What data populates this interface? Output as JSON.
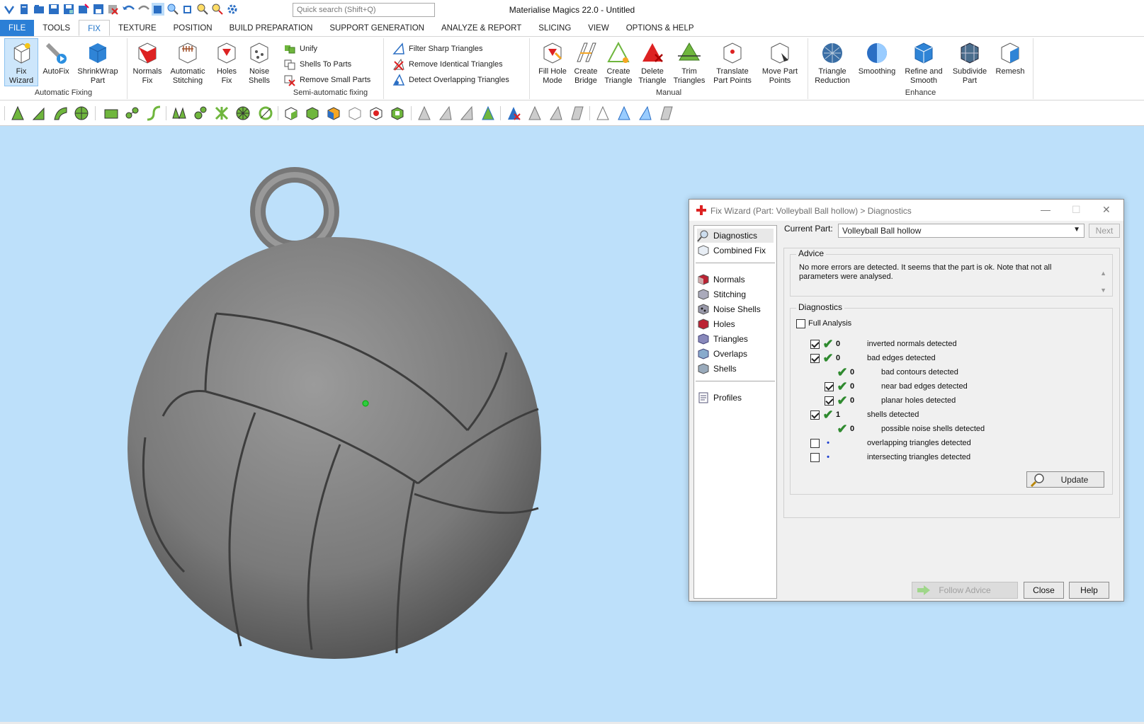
{
  "window": {
    "title": "Materialise Magics 22.0 - Untitled"
  },
  "quick_access": {
    "search_placeholder": "Quick search (Shift+Q)"
  },
  "menu": [
    "FILE",
    "TOOLS",
    "FIX",
    "TEXTURE",
    "POSITION",
    "BUILD PREPARATION",
    "SUPPORT GENERATION",
    "ANALYZE & REPORT",
    "SLICING",
    "VIEW",
    "OPTIONS & HELP"
  ],
  "ribbon": {
    "automatic_fixing": {
      "label": "Automatic Fixing",
      "fix_wizard": "Fix\nWizard",
      "autofix": "AutoFix",
      "shrinkwrap": "ShrinkWrap\nPart"
    },
    "fix_group": {
      "normals": "Normals\nFix",
      "stitching": "Automatic\nStitching",
      "holes": "Holes\nFix",
      "noise": "Noise\nShells"
    },
    "semi_automatic": {
      "label": "Semi-automatic fixing",
      "unify": "Unify",
      "shells_to_parts": "Shells To Parts",
      "remove_small": "Remove Small Parts"
    },
    "triangles": {
      "filter_sharp": "Filter Sharp Triangles",
      "remove_identical": "Remove Identical Triangles",
      "detect_overlapping": "Detect Overlapping Triangles"
    },
    "manual": {
      "label": "Manual",
      "fill_hole": "Fill Hole\nMode",
      "create_bridge": "Create\nBridge",
      "create_triangle": "Create\nTriangle",
      "delete_triangle": "Delete\nTriangle",
      "trim_triangles": "Trim\nTriangles",
      "translate_points": "Translate\nPart Points",
      "move_points": "Move Part\nPoints"
    },
    "enhance": {
      "label": "Enhance",
      "triangle_reduction": "Triangle\nReduction",
      "smoothing": "Smoothing",
      "refine_smooth": "Refine and\nSmooth",
      "subdivide": "Subdivide\nPart",
      "remesh": "Remesh"
    }
  },
  "dialog": {
    "title": "Fix Wizard (Part: Volleyball Ball hollow) > Diagnostics",
    "nav": {
      "diagnostics": "Diagnostics",
      "combined_fix": "Combined Fix",
      "normals": "Normals",
      "stitching": "Stitching",
      "noise_shells": "Noise Shells",
      "holes": "Holes",
      "triangles": "Triangles",
      "overlaps": "Overlaps",
      "shells": "Shells",
      "profiles": "Profiles"
    },
    "current_part_label": "Current Part:",
    "current_part_value": "Volleyball Ball hollow",
    "next_label": "Next",
    "advice_label": "Advice",
    "advice_text": "No more errors are detected. It seems that the part is ok. Note that not all parameters were analysed.",
    "diagnostics_label": "Diagnostics",
    "full_analysis_label": "Full Analysis",
    "rows": [
      {
        "count": "0",
        "text": "inverted normals detected"
      },
      {
        "count": "0",
        "text": "bad edges detected"
      },
      {
        "count": "0",
        "text": "bad contours detected"
      },
      {
        "count": "0",
        "text": "near bad edges detected"
      },
      {
        "count": "0",
        "text": "planar holes detected"
      },
      {
        "count": "1",
        "text": "shells detected"
      },
      {
        "count": "0",
        "text": "possible noise shells detected"
      },
      {
        "count": "",
        "text": "overlapping triangles detected"
      },
      {
        "count": "",
        "text": "intersecting triangles detected"
      }
    ],
    "update_label": "Update",
    "follow_advice_label": "Follow Advice",
    "close_label": "Close",
    "help_label": "Help"
  },
  "colors": {
    "viewport_bg": "#bde0fa",
    "accent": "#2b7fd6",
    "check": "#2f8a2f"
  }
}
